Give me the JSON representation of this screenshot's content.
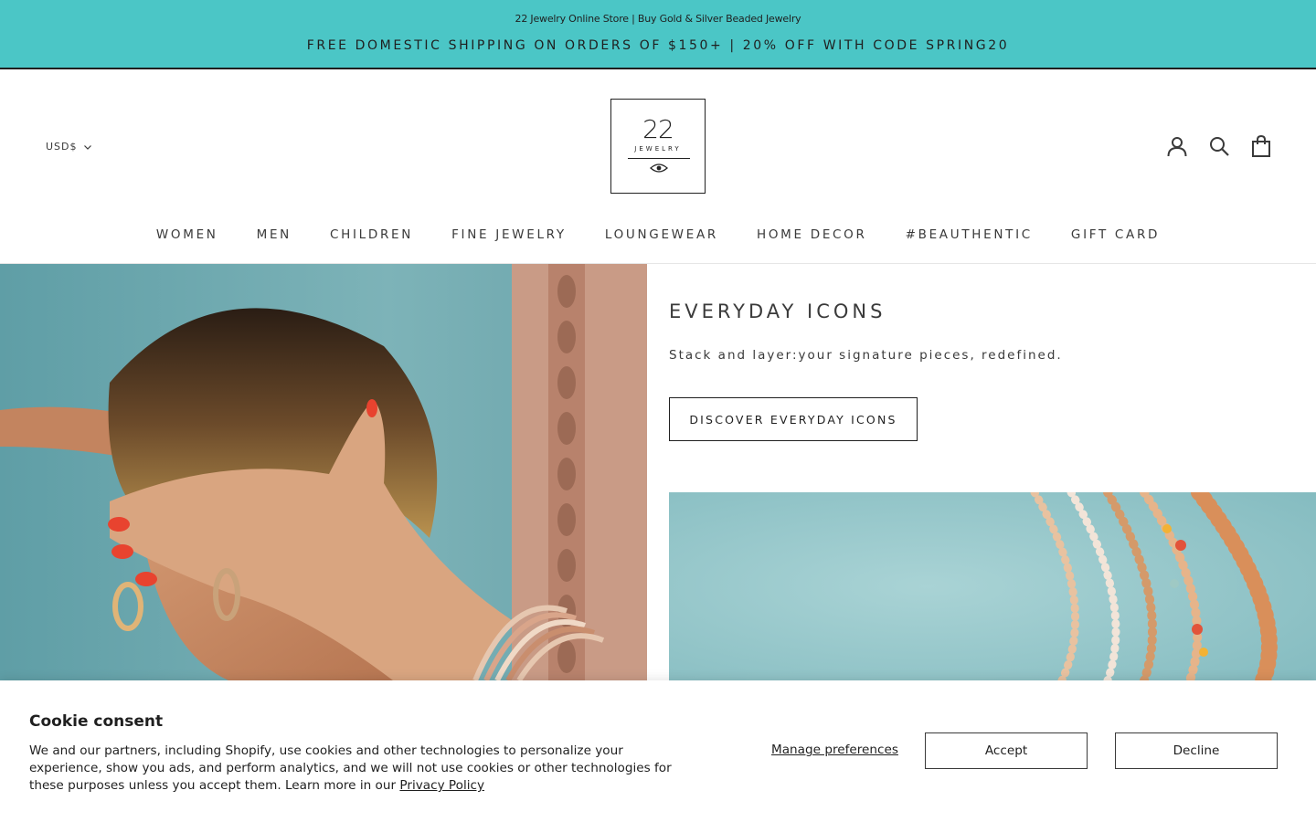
{
  "announcement": {
    "title": "22 Jewelry Online Store | Buy Gold & Silver Beaded Jewelry",
    "promo": "FREE DOMESTIC SHIPPING ON ORDERS OF $150+ | 20% OFF WITH CODE SPRING20"
  },
  "header": {
    "currency": "USD$",
    "logo": {
      "number": "22",
      "word": "JEWELRY"
    },
    "icons": [
      "account-icon",
      "search-icon",
      "cart-icon"
    ]
  },
  "nav": {
    "items": [
      "WOMEN",
      "MEN",
      "CHILDREN",
      "FINE JEWELRY",
      "LOUNGEWEAR",
      "HOME DECOR",
      "#BEAUTHENTIC",
      "GIFT CARD"
    ]
  },
  "hero": {
    "heading": "EVERYDAY ICONS",
    "subheading": "Stack and layer:your signature pieces, redefined.",
    "button": "DISCOVER EVERYDAY ICONS"
  },
  "cookie": {
    "title": "Cookie consent",
    "body": "We and our partners, including Shopify, use cookies and other technologies to personalize your experience, show you ads, and perform analytics, and we will not use cookies or other technologies for these purposes unless you accept them. Learn more in our ",
    "privacy_link": "Privacy Policy",
    "manage": "Manage preferences",
    "accept": "Accept",
    "decline": "Decline"
  },
  "colors": {
    "announcement_bg": "#4bc6c6",
    "text": "#3a3a3a",
    "border_dark": "#1f1f1f"
  }
}
